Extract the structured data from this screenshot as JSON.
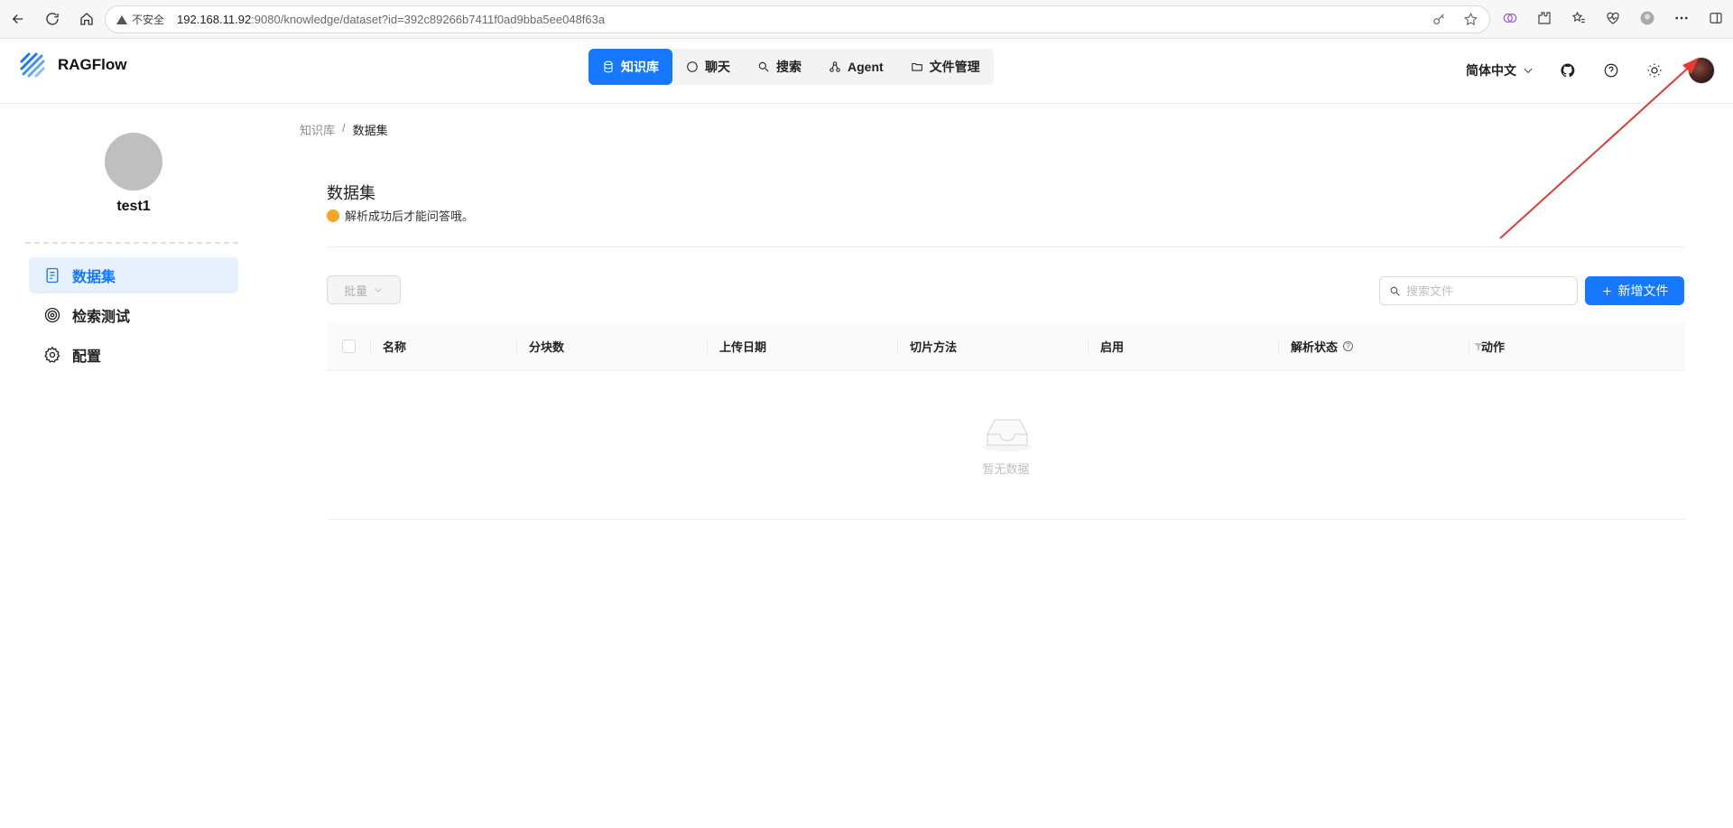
{
  "browser": {
    "security_label": "不安全",
    "url_host": "192.168.11.92",
    "url_rest": ":9080/knowledge/dataset?id=392c89266b7411f0ad9bba5ee048f63a"
  },
  "app": {
    "logo_text": "RAGFlow",
    "tabs": [
      {
        "label": "知识库",
        "icon": "database-icon"
      },
      {
        "label": "聊天",
        "icon": "chat-icon"
      },
      {
        "label": "搜索",
        "icon": "search-icon"
      },
      {
        "label": "Agent",
        "icon": "agent-icon"
      },
      {
        "label": "文件管理",
        "icon": "folder-icon"
      }
    ],
    "language": "简体中文",
    "accent_color": "#1677ff"
  },
  "sidebar": {
    "profile_name": "test1",
    "items": [
      {
        "label": "数据集",
        "icon": "document-icon"
      },
      {
        "label": "检索测试",
        "icon": "target-icon"
      },
      {
        "label": "配置",
        "icon": "gear-icon"
      }
    ]
  },
  "breadcrumb": {
    "parent": "知识库",
    "separator": "/",
    "current": "数据集"
  },
  "main": {
    "title": "数据集",
    "hint": "解析成功后才能问答哦。",
    "batch_label": "批量",
    "search_placeholder": "搜索文件",
    "add_label": "新增文件",
    "columns": [
      "名称",
      "分块数",
      "上传日期",
      "切片方法",
      "启用",
      "解析状态",
      "动作"
    ],
    "empty_text": "暂无数据"
  }
}
